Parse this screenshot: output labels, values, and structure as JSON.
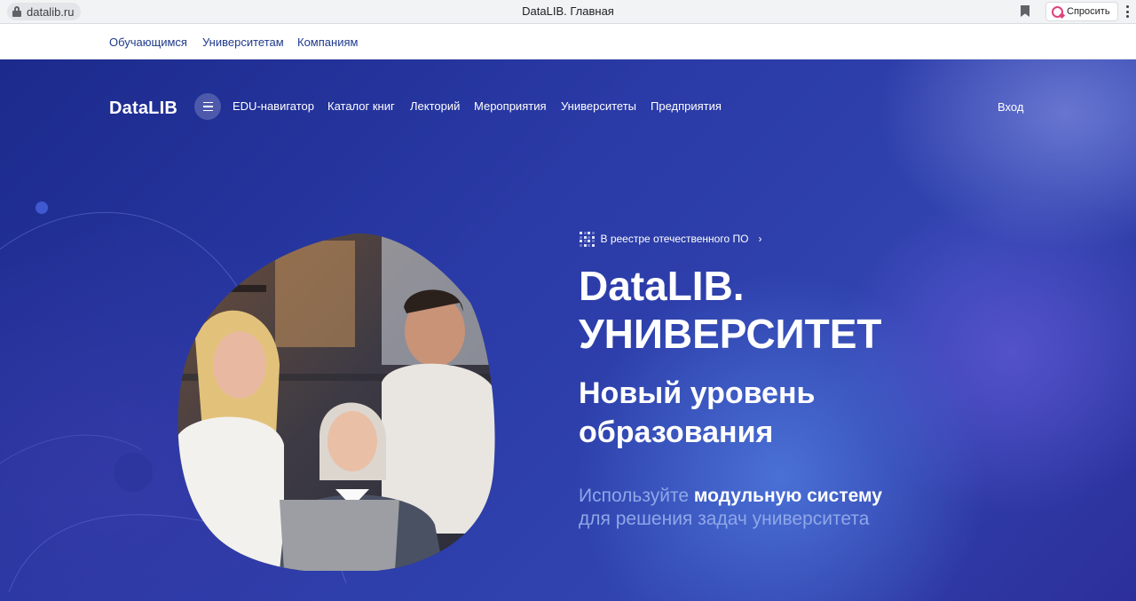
{
  "browser": {
    "url": "datalib.ru",
    "title": "DataLIB. Главная",
    "ask_label": "Спросить"
  },
  "audience": {
    "items": [
      "Обучающимся",
      "Университетам",
      "Компаниям"
    ]
  },
  "header": {
    "logo": "DataLIB",
    "nav": [
      "EDU-навигатор",
      "Каталог книг",
      "Лекторий",
      "Мероприятия",
      "Университеты",
      "Предприятия"
    ],
    "login": "Вход"
  },
  "hero": {
    "badge": "В реестре отечественного ПО",
    "title_line1": "DataLIB.",
    "title_line2": "УНИВЕРСИТЕТ",
    "subtitle_line1": "Новый уровень",
    "subtitle_line2": "образования",
    "desc_part1": "Используйте ",
    "desc_bold": "модульную систему",
    "desc_line2": "для решения задач университета"
  },
  "colors": {
    "hero_bg": "#2a3aa6",
    "link": "#1e3a8c",
    "desc_muted": "#8fa7e8"
  },
  "icons": {
    "lock": "lock-icon",
    "bookmark": "bookmark-icon",
    "ask": "ask-icon",
    "menu": "kebab-menu-icon",
    "burger": "hamburger-icon",
    "registry": "dots-grid-icon",
    "chevron": "chevron-right-icon"
  }
}
